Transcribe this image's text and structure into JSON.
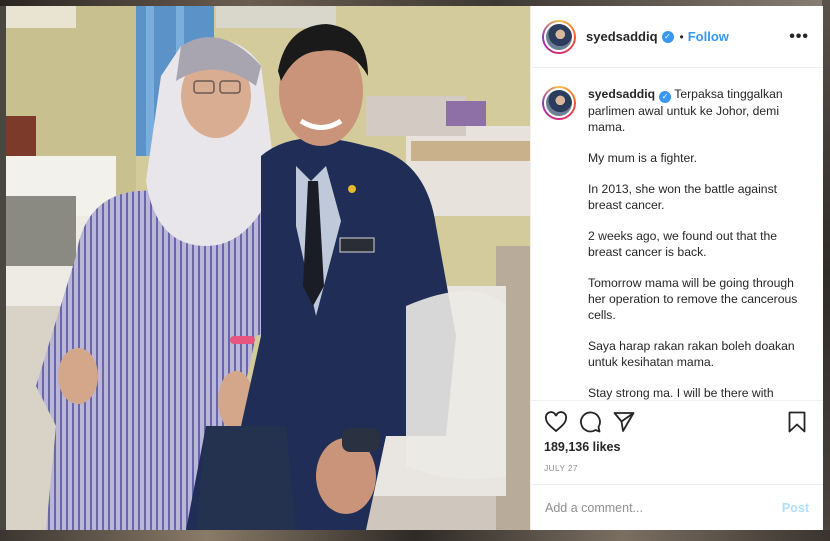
{
  "post": {
    "username": "syedsaddiq",
    "verified_icon": "verified-badge-icon",
    "dot": "•",
    "follow_label": "Follow",
    "more_icon": "•••",
    "caption_username": "syedsaddiq",
    "caption_lines": [
      "Terpaksa tinggalkan parlimen awal untuk ke Johor, demi mama.",
      "My mum is a fighter.",
      "In 2013, she won the battle against breast cancer.",
      "2 weeks ago, we found out that the breast cancer is back.",
      "Tomorrow mama will be going through her operation to remove the cancerous cells.",
      "Saya harap rakan rakan boleh doakan untuk kesihatan mama.",
      "Stay strong ma. I will be there with"
    ],
    "likes": "189,136 likes",
    "date": "JULY 27",
    "comment_placeholder": "Add a comment...",
    "post_label": "Post"
  },
  "icons": {
    "like": "heart-icon",
    "comment": "comment-icon",
    "share": "paper-plane-icon",
    "save": "bookmark-icon"
  },
  "colors": {
    "accent": "#3897f0",
    "post_disabled": "#b2dffc",
    "text": "#262626",
    "muted": "#8e8e8e"
  }
}
